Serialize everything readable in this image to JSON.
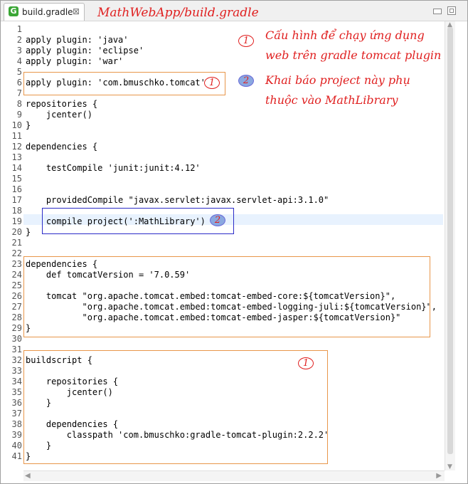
{
  "tab": {
    "icon_letter": "G",
    "label": "build.gradle",
    "close_glyph": "⊠"
  },
  "file_path": "MathWebApp/build.gradle",
  "code_lines": [
    {
      "n": "1",
      "text": ""
    },
    {
      "n": "2",
      "text": "apply plugin: 'java'"
    },
    {
      "n": "3",
      "text": "apply plugin: 'eclipse'"
    },
    {
      "n": "4",
      "text": "apply plugin: 'war'"
    },
    {
      "n": "5",
      "text": ""
    },
    {
      "n": "6",
      "text": "apply plugin: 'com.bmuschko.tomcat'"
    },
    {
      "n": "7",
      "text": ""
    },
    {
      "n": "8",
      "text": "repositories {"
    },
    {
      "n": "9",
      "text": "    jcenter()"
    },
    {
      "n": "10",
      "text": "}"
    },
    {
      "n": "11",
      "text": ""
    },
    {
      "n": "12",
      "text": "dependencies {"
    },
    {
      "n": "13",
      "text": ""
    },
    {
      "n": "14",
      "text": "    testCompile 'junit:junit:4.12'"
    },
    {
      "n": "15",
      "text": ""
    },
    {
      "n": "16",
      "text": ""
    },
    {
      "n": "17",
      "text": "    providedCompile \"javax.servlet:javax.servlet-api:3.1.0\""
    },
    {
      "n": "18",
      "text": ""
    },
    {
      "n": "19",
      "text": "    compile project(':MathLibrary')"
    },
    {
      "n": "20",
      "text": "}"
    },
    {
      "n": "21",
      "text": ""
    },
    {
      "n": "22",
      "text": ""
    },
    {
      "n": "23",
      "text": "dependencies {"
    },
    {
      "n": "24",
      "text": "    def tomcatVersion = '7.0.59'"
    },
    {
      "n": "25",
      "text": ""
    },
    {
      "n": "26",
      "text": "    tomcat \"org.apache.tomcat.embed:tomcat-embed-core:${tomcatVersion}\","
    },
    {
      "n": "27",
      "text": "           \"org.apache.tomcat.embed:tomcat-embed-logging-juli:${tomcatVersion}\","
    },
    {
      "n": "28",
      "text": "           \"org.apache.tomcat.embed:tomcat-embed-jasper:${tomcatVersion}\""
    },
    {
      "n": "29",
      "text": "}"
    },
    {
      "n": "30",
      "text": ""
    },
    {
      "n": "31",
      "text": ""
    },
    {
      "n": "32",
      "text": "buildscript {"
    },
    {
      "n": "33",
      "text": ""
    },
    {
      "n": "34",
      "text": "    repositories {"
    },
    {
      "n": "35",
      "text": "        jcenter()"
    },
    {
      "n": "36",
      "text": "    }"
    },
    {
      "n": "37",
      "text": ""
    },
    {
      "n": "38",
      "text": "    dependencies {"
    },
    {
      "n": "39",
      "text": "        classpath 'com.bmuschko:gradle-tomcat-plugin:2.2.2'"
    },
    {
      "n": "40",
      "text": "    }"
    },
    {
      "n": "41",
      "text": "}"
    }
  ],
  "annotations": {
    "note1_line1": "Cấu hình để chạy ứng dụng",
    "note1_line2": "web trên gradle tomcat plugin",
    "note2_line1": "Khai báo project này phụ",
    "note2_line2": "thuộc vào MathLibrary",
    "marker1": "1",
    "marker2": "2"
  },
  "colors": {
    "annotation_red": "#e02020",
    "box_orange": "#e8964a",
    "box_blue": "#2b2bc8",
    "gradle_green": "#3aa635"
  }
}
